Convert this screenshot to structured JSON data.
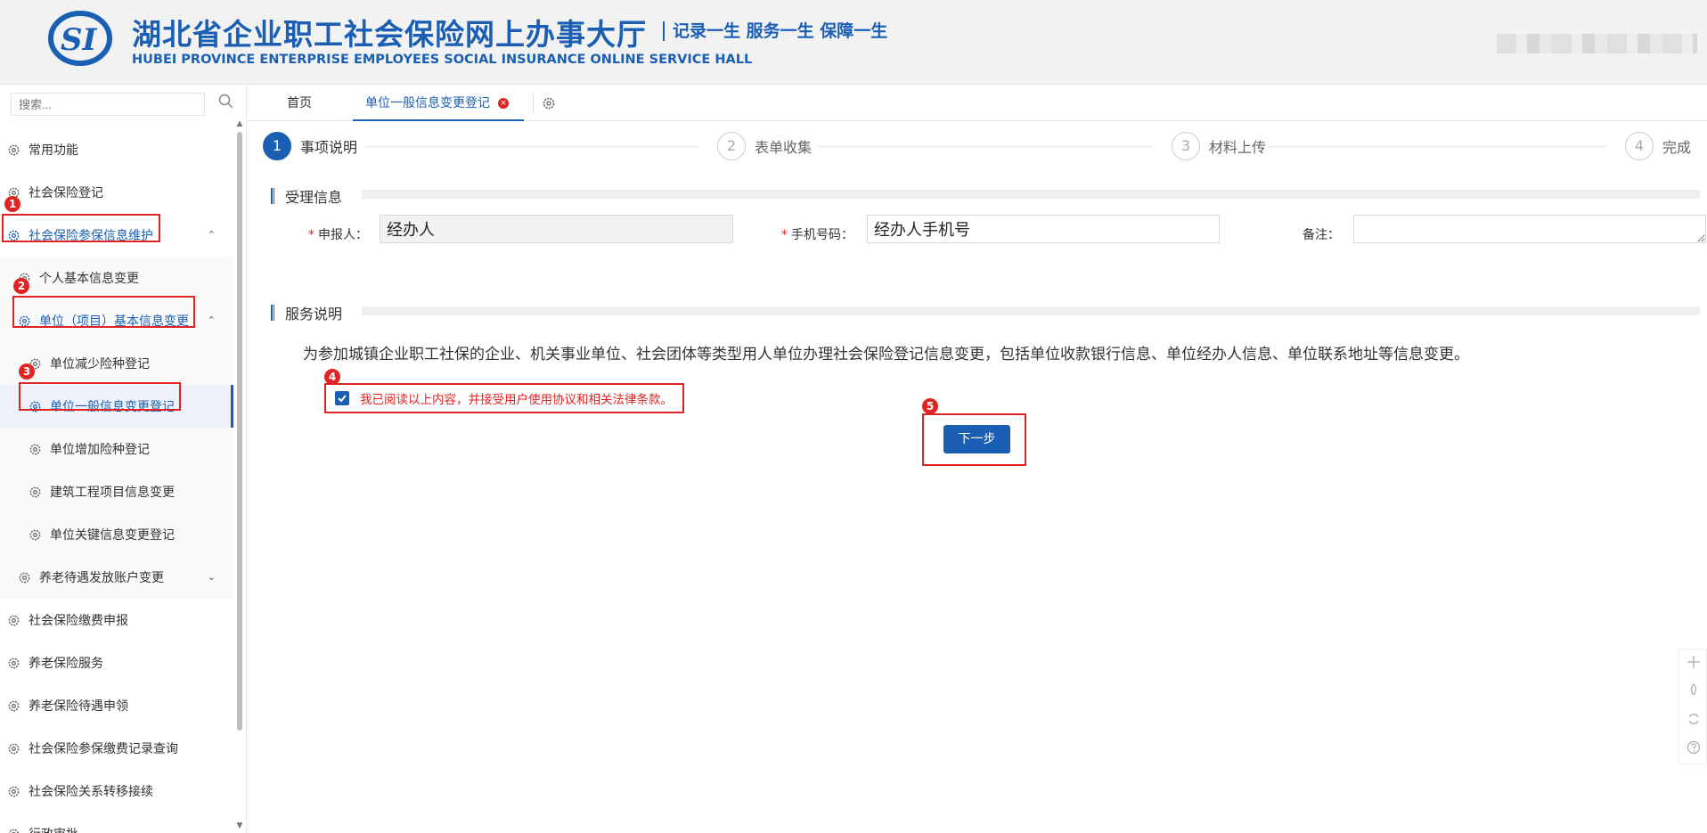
{
  "header": {
    "title_cn": "湖北省企业职工社会保险网上办事大厅",
    "slogan": "记录一生 服务一生 保障一生",
    "title_en": "HUBEI PROVINCE ENTERPRISE EMPLOYEES SOCIAL INSURANCE ONLINE SERVICE HALL"
  },
  "sidebar": {
    "search_placeholder": "搜索...",
    "items": [
      {
        "label": "常用功能"
      },
      {
        "label": "社会保险登记"
      },
      {
        "label": "社会保险参保信息维护",
        "arrow": "⌃"
      },
      {
        "label": "个人基本信息变更"
      },
      {
        "label": "单位（项目）基本信息变更",
        "arrow": "⌃"
      },
      {
        "label": "单位减少险种登记"
      },
      {
        "label": "单位一般信息变更登记"
      },
      {
        "label": "单位增加险种登记"
      },
      {
        "label": "建筑工程项目信息变更"
      },
      {
        "label": "单位关键信息变更登记"
      },
      {
        "label": "养老待遇发放账户变更",
        "arrow": "⌄"
      },
      {
        "label": "社会保险缴费申报"
      },
      {
        "label": "养老保险服务"
      },
      {
        "label": "养老保险待遇申领"
      },
      {
        "label": "社会保险参保缴费记录查询"
      },
      {
        "label": "社会保险关系转移接续"
      },
      {
        "label": "行政审批"
      }
    ]
  },
  "badges": [
    "1",
    "2",
    "3",
    "4",
    "5"
  ],
  "tabs": {
    "home": "首页",
    "active": "单位一般信息变更登记",
    "close_glyph": "×"
  },
  "steps": [
    {
      "num": "1",
      "label": "事项说明"
    },
    {
      "num": "2",
      "label": "表单收集"
    },
    {
      "num": "3",
      "label": "材料上传"
    },
    {
      "num": "4",
      "label": "完成"
    }
  ],
  "section_accept": {
    "title": "受理信息",
    "applicant_label": "申报人：",
    "applicant_value": "经办人",
    "phone_label": "手机号码：",
    "phone_value": "经办人手机号",
    "remark_label": "备注：",
    "remark_value": "",
    "required_mark": "*"
  },
  "section_service": {
    "title": "服务说明",
    "description": "为参加城镇企业职工社保的企业、机关事业单位、社会团体等类型用人单位办理社会保险登记信息变更，包括单位收款银行信息、单位经办人信息、单位联系地址等信息变更。",
    "agree_text": "我已阅读以上内容，并接受用户使用协议和相关法律条款。",
    "agree_checked": true
  },
  "next_button": "下一步",
  "colors": {
    "brand": "#1a5fb4",
    "annotation": "#e02424"
  }
}
